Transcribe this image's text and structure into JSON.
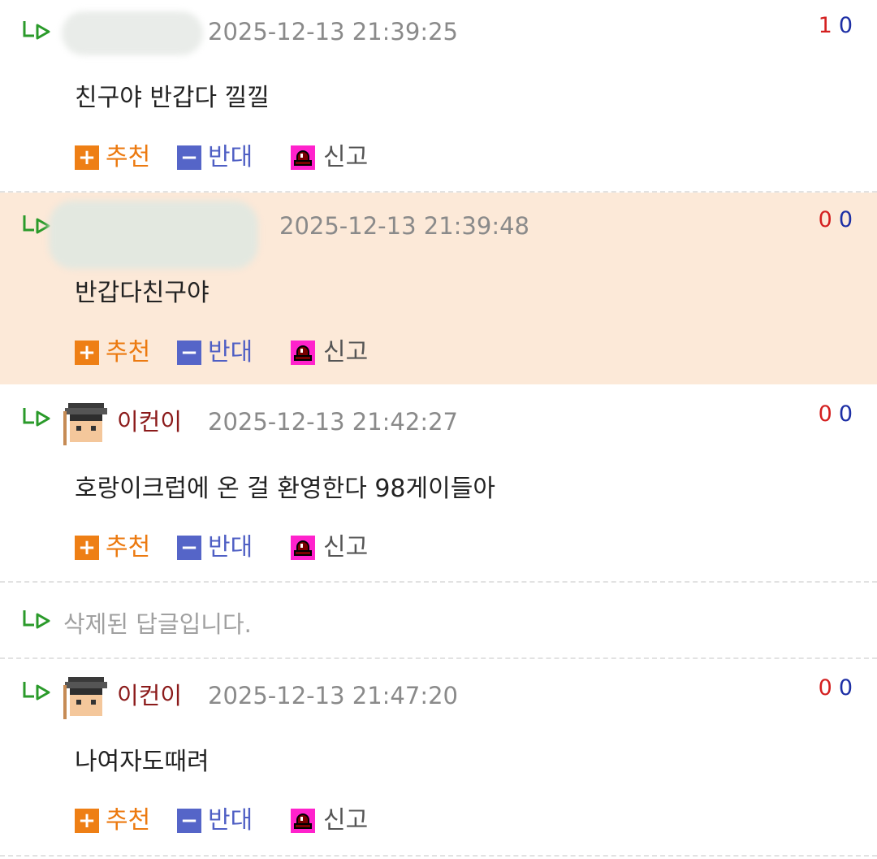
{
  "actions": {
    "recommend_label": "추천",
    "oppose_label": "반대",
    "report_label": "신고",
    "recommend_icon": "plus-icon",
    "oppose_icon": "minus-icon",
    "report_icon": "siren-icon"
  },
  "colors": {
    "highlight_bg": "#fce9d8",
    "nick_color": "#8b1a1a",
    "up_vote_color": "#d42020",
    "down_vote_color": "#1d2fa5",
    "recommend_color": "#ee7f15",
    "oppose_color": "#5565c8",
    "report_color": "#ff22cc",
    "reply_arrow_color": "#2a9a2a"
  },
  "comments": [
    {
      "author": "",
      "date": "2025-12-13 21:39:25",
      "text": "친구야 반갑다 낄낄",
      "up": "1",
      "down": "0",
      "author_blurred": true
    },
    {
      "author": "",
      "date": "2025-12-13 21:39:48",
      "text": "반갑다친구야",
      "up": "0",
      "down": "0",
      "author_blurred": true,
      "highlighted": true
    },
    {
      "author": "이컨이",
      "date": "2025-12-13 21:42:27",
      "text": "호랑이크럽에 온 걸 환영한다 98게이들아",
      "up": "0",
      "down": "0"
    },
    {
      "deleted": true,
      "text": "삭제된 답글입니다."
    },
    {
      "author": "이컨이",
      "date": "2025-12-13 21:47:20",
      "text": "나여자도때려",
      "up": "0",
      "down": "0"
    }
  ]
}
